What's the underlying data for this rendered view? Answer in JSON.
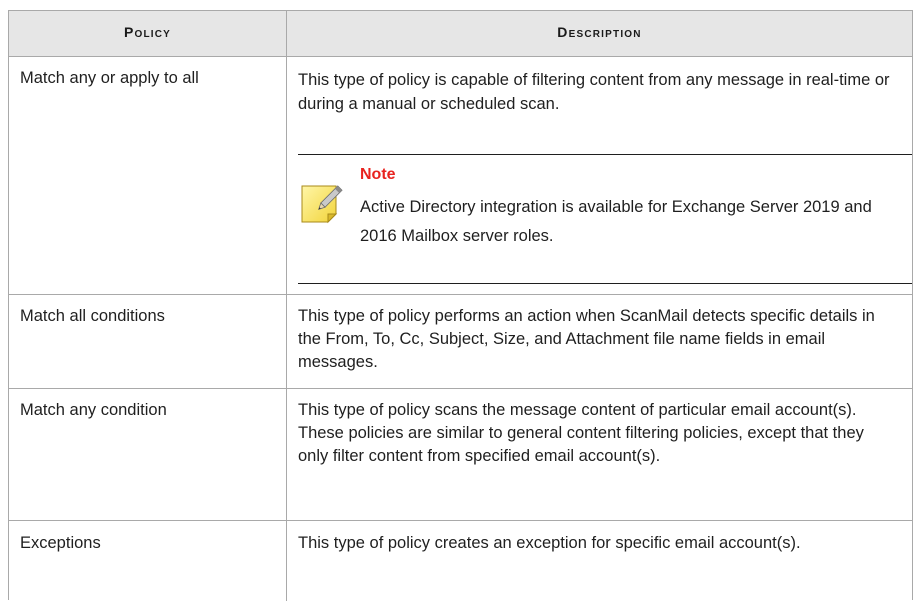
{
  "table": {
    "headers": {
      "policy": "Policy",
      "description": "Description"
    },
    "rows": [
      {
        "policy": "Match any or apply to all",
        "description": "This type of policy is capable of filtering content from any message in real-time or during a manual or scheduled scan.",
        "note": {
          "title": "Note",
          "body": "Active Directory integration is available for Exchange Server 2019 and 2016 Mailbox server roles."
        }
      },
      {
        "policy": "Match all conditions",
        "description": "This type of policy performs an action when ScanMail detects specific details in the From, To, Cc, Subject, Size, and Attachment file name fields in email messages."
      },
      {
        "policy": "Match any condition",
        "description": "This type of policy scans the message content of particular email account(s). These policies are similar to general content filtering policies, except that they only filter content from specified email account(s)."
      },
      {
        "policy": "Exceptions",
        "description": "This type of policy creates an exception for specific email account(s)."
      }
    ]
  },
  "colors": {
    "header_bg": "#e6e6e6",
    "border": "#a9a9a9",
    "note_title": "#e8231f"
  },
  "icons": {
    "note": "note-pencil-icon"
  }
}
